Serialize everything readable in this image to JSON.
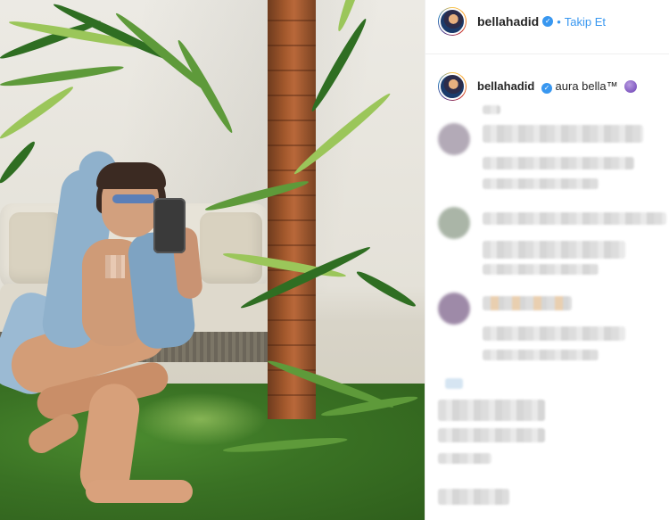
{
  "post": {
    "username": "bellahadid",
    "follow_label": "Takip Et",
    "separator": "•",
    "caption_text": "aura bella™"
  },
  "icons": {
    "verified": "verified-badge-icon",
    "caption_emoji": "purple-emoji-icon"
  },
  "colors": {
    "link": "#3897f0",
    "text": "#262626",
    "divider": "#efefef"
  }
}
